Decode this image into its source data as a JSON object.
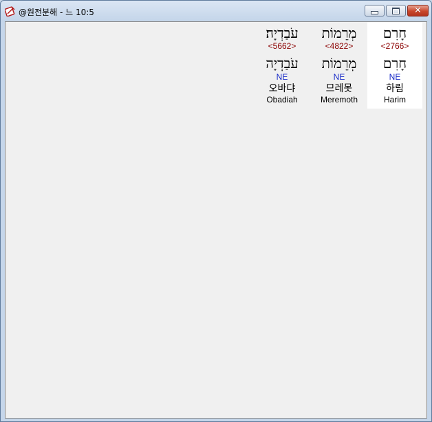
{
  "window": {
    "title": "@원전분해 - 느 10:5",
    "icon": "app-icon"
  },
  "words": [
    {
      "hebrew": "חָרִם",
      "strong": "<2766>",
      "hebrew_lemma": "חָרִם",
      "pos": "NE",
      "korean": "하림",
      "english": "Harim",
      "selected": true
    },
    {
      "hebrew": "מְרֵמוֹת",
      "strong": "<4822>",
      "hebrew_lemma": "מְרֵמוֹת",
      "pos": "NE",
      "korean": "므레못",
      "english": "Meremoth",
      "selected": false
    },
    {
      "hebrew": "עֹבַדְיָה׃",
      "strong": "<5662>",
      "hebrew_lemma": "עֹבַדְיָה",
      "pos": "NE",
      "korean": "오바댜",
      "english": "Obadiah",
      "selected": false
    }
  ]
}
